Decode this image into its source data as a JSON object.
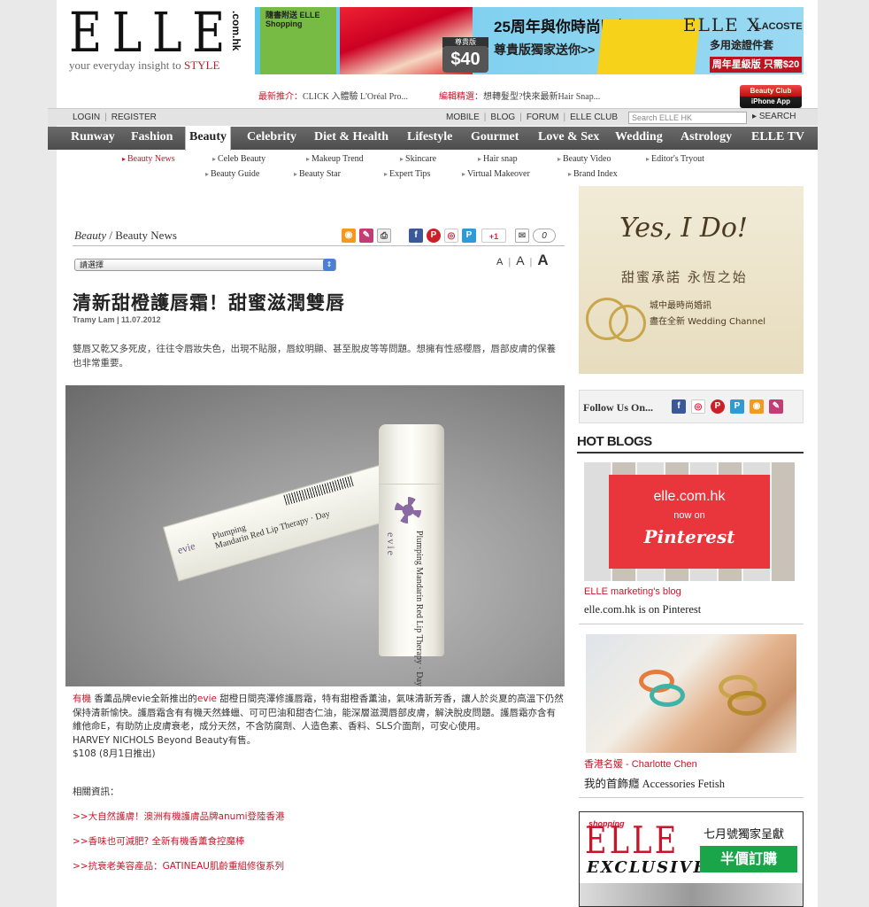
{
  "header": {
    "logo_text": "ELLE",
    "logo_domain": ".com.hk",
    "tagline_prefix": "your everyday insight to ",
    "tagline_accent": "STYLE"
  },
  "banner_ad": {
    "gift_label": "隨書附送 ELLE Shopping",
    "price_tag": "尊貴版",
    "price": "$40",
    "title": "25周年與你時尚同行",
    "subtitle": "尊貴版獨家送你>>",
    "brand_right": "ELLE X",
    "brand_lacoste": "LACOSTE",
    "right_sub": "多用途證件套",
    "right_price": "周年星級版 只需$20"
  },
  "promo": {
    "label1": "最新推介：",
    "text1": "CLICK 入體驗 L'Oréal Pro...",
    "label2": "編輯精選：",
    "text2": "想轉髮型?快來最新Hair Snap...",
    "app_line1": "Beauty Club",
    "app_line2": "iPhone App"
  },
  "utility": {
    "login": "LOGIN",
    "register": "REGISTER",
    "links": [
      "MOBILE",
      "BLOG",
      "FORUM",
      "ELLE CLUB"
    ],
    "search_placeholder": "Search ELLE HK",
    "search_button": "SEARCH"
  },
  "nav": {
    "items": [
      "Runway",
      "Fashion",
      "Beauty",
      "Celebrity",
      "Diet & Health",
      "Lifestyle",
      "Gourmet",
      "Love & Sex",
      "Wedding",
      "Astrology",
      "ELLE TV"
    ],
    "active": "Beauty"
  },
  "subnav": {
    "row1": [
      "Beauty News",
      "Celeb Beauty",
      "Makeup Trend",
      "Skincare",
      "Hair snap",
      "Beauty Video",
      "Editor's Tryout"
    ],
    "row2": [
      "Beauty Guide",
      "Beauty Star",
      "Expert Tips",
      "Virtual Makeover",
      "Brand Index"
    ]
  },
  "breadcrumb": {
    "section": "Beauty",
    "separator": " / ",
    "page": "Beauty News"
  },
  "share": {
    "gplus": "+1",
    "count": "0"
  },
  "select": {
    "value": "請選擇"
  },
  "font_sizes": [
    "A",
    "A",
    "A"
  ],
  "article": {
    "title": "清新甜橙護唇霜！甜蜜滋潤雙唇",
    "byline": "Tramy Lam | 11.07.2012",
    "intro": "雙唇又乾又多死皮，往往令唇妝失色，出現不貼服，唇紋明顯、甚至脫皮等等問題。想擁有性感櫻唇，唇部皮膚的保養也非常重要。",
    "photo": {
      "box_brand": "evie",
      "box_label1": "Plumping",
      "box_label2": "Mandarin Red Lip Therapy · Day",
      "tube_brand": "evie",
      "tube_text": "Plumping  Mandarin Red Lip Therapy · Day"
    },
    "body_red1": "有機",
    "body_p1a": " 香薰品牌evie全新推出的",
    "body_red2": "evie",
    "body_p1b": " 甜橙日間亮澤修護唇霜，特有甜橙香薰油，氣味清新芳香，讓人於炎夏的高溫下仍然保持清新愉快。護唇霜含有有機天然蜂蠟、可可巴油和甜杏仁油，能深層滋潤唇部皮膚，解決脫皮問題。護唇霜亦含有維他命E，有助防止皮膚衰老，成分天然，不含防腐劑、人造色素、香料、SLS介面劑，可安心使用。",
    "stockist": "HARVEY NICHOLS Beyond Beauty有售。",
    "price": "$108 (8月1日推出)",
    "related_heading": "相關資訊：",
    "related": [
      ">>大自然護膚！澳洲有機護膚品牌anumi登陸香港",
      ">>香味也可減肥? 全新有機香薰食控魔棒",
      ">>抗衰老美容產品：GATINEAU肌齡重組修復系列"
    ]
  },
  "sidebar": {
    "wedding_ad": {
      "headline": "Yes, I Do!",
      "sub": "甜蜜承諾 永恆之始",
      "line1": "城中最時尚婚訊",
      "line2": "盡在全新 Wedding Channel"
    },
    "follow_label": "Follow Us On...",
    "hot_blogs_heading": "HOT BLOGS",
    "blogs": [
      {
        "pin_line1": "elle.com.hk",
        "pin_line2": "now on",
        "pin_line3": "Pinterest",
        "caption": "ELLE marketing's blog",
        "title": "elle.com.hk is on Pinterest"
      },
      {
        "caption": "香港名媛 - Charlotte Chen",
        "title": "我的首飾癮 Accessories Fetish"
      }
    ],
    "shop_ad": {
      "shopping": "shopping",
      "elle": "ELLE",
      "exclusive": "EXCLUSIVE",
      "line1": "七月號獨家呈獻",
      "button": "半價訂購"
    }
  },
  "colors": {
    "accent_red": "#c7162b",
    "nav_bg": "#5a5a5a",
    "page_bg": "#e9e9e9"
  }
}
